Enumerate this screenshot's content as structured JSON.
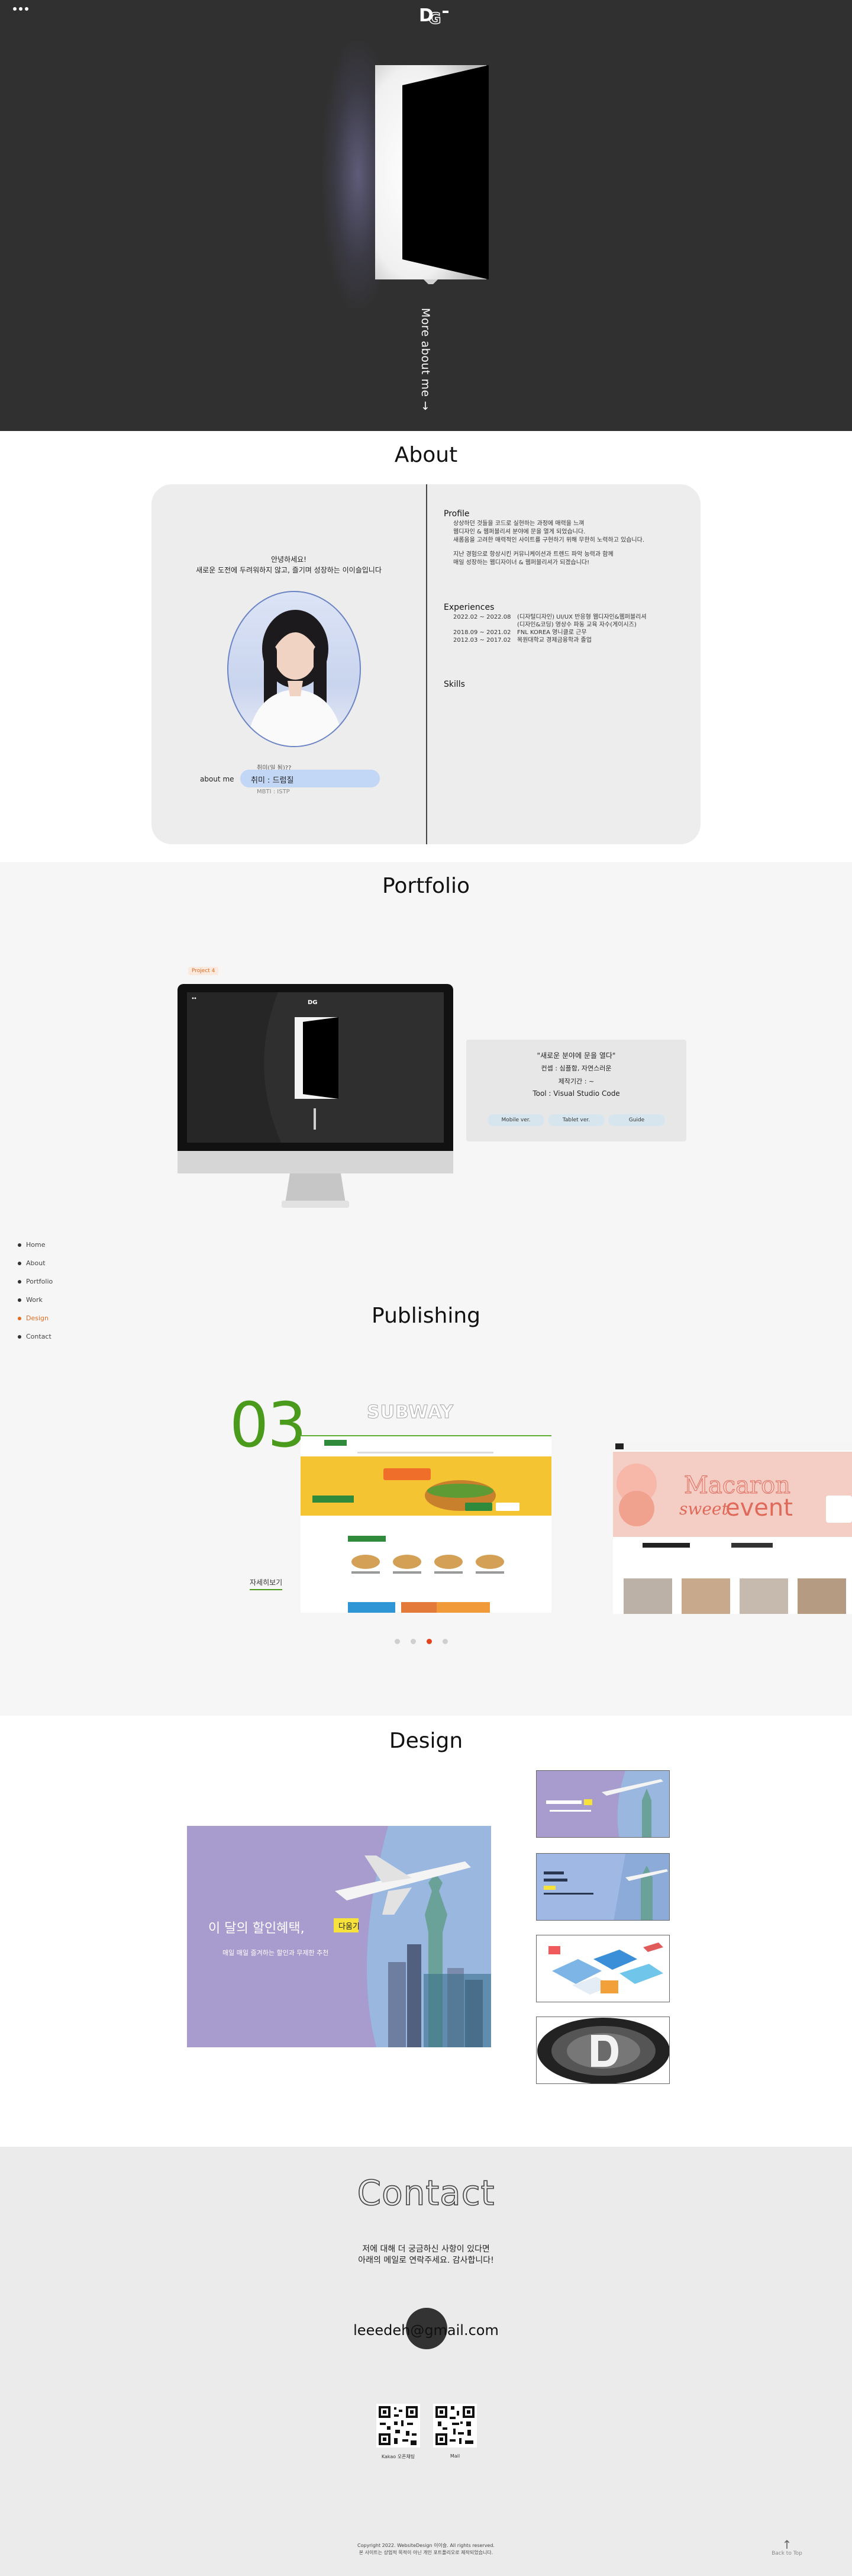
{
  "hero": {
    "more_about": "More about me →"
  },
  "about": {
    "title": "About",
    "greeting_line1": "안녕하세요!",
    "greeting_line2": "새로운 도전에 두려워하지 않고, 즐기며 성장하는 이이슬입니다",
    "about_me_label": "about me",
    "hobby": "취미(일 됨)??",
    "name_pill": "취미 : 드럼질",
    "mbti": "MBTI : ISTP",
    "profile_heading": "Profile",
    "profile_lines": [
      "상상하던 것들을 코드로 실현하는 과정에 매력을 느껴",
      "웹디자인 & 웹퍼블리셔 분야에 문을 열게 되었습니다.",
      "새롭움을 고려한 매력적인 사이트를 구현하기 위해 무한히 노력하고 있습니다.",
      "",
      "지난 경험으로 항상시킨 커뮤니케이션과 트렌드 파악 능력과 함께",
      "매일 성장하는 웹디자이너 & 웹퍼블리셔가 되겠습니다!"
    ],
    "experiences_heading": "Experiences",
    "experiences": [
      {
        "period": "2022.02 ~ 2022.08",
        "desc": "(디자털디자인) UI/UX 반응형 웹디자인&웹퍼블리셔"
      },
      {
        "period": "",
        "desc": "(디자인&코딩) 영상수 파동 교육 자수(게이시즈)"
      },
      {
        "period": "2018.09 ~ 2021.02",
        "desc": "FNL KOREA 영니클로 근무"
      },
      {
        "period": "2012.03 ~ 2017.02",
        "desc": "목원대학교 경제금융학과 졸업"
      }
    ],
    "skills_heading": "Skills"
  },
  "portfolio": {
    "title": "Portfolio",
    "badge": "Project 4",
    "card_line1": "\"새로운 분야에 문을 열다\"",
    "card_line2": "컨셉 : 심플함, 자연스러운",
    "card_line3": "제작기간 : ~",
    "card_line4": "Tool : Visual Studio Code",
    "btn_mobile": "Mobile ver.",
    "btn_tablet": "Tablet ver.",
    "btn_guide": "Guide"
  },
  "side_nav": [
    "Home",
    "About",
    "Portfolio",
    "Work",
    "Design",
    "Contact"
  ],
  "publishing": {
    "title": "Publishing",
    "number": "03",
    "project_title": "SUBWAY",
    "more_link": "자세히보기",
    "next_banner_line1": "Macaron",
    "next_banner_line2": "sweet",
    "next_banner_line3": "event"
  },
  "design": {
    "title": "Design",
    "banner_line1": "이 달의 할인혜택,",
    "banner_tag": "다움기",
    "banner_line2": "매일 매일 즐겨하는 할인과 무제한 추천"
  },
  "contact": {
    "title": "Contact",
    "msg_line1": "저에 대해 더 궁금하신 사항이 있다면",
    "msg_line2": "아래의 메일로 연락주세요. 감사합니다!",
    "email": "leeedeh@gmail.com",
    "qr1_caption": "Kakao 오픈채팅",
    "qr2_caption": "Mail",
    "copyright_line1": "Copyright 2022. WebsiteDesign 이이슬. All rights reserved.",
    "copyright_line2": "본 사이트는 상업적 목적이 아닌 개인 포트폴리오로 제작되었습니다.",
    "back_to_top": "Back to Top"
  },
  "colors": {
    "hero_bg": "#303030",
    "accent_orange": "#e46c23",
    "publishing_green": "#4a9a1c",
    "dot_active": "#e5431d"
  }
}
